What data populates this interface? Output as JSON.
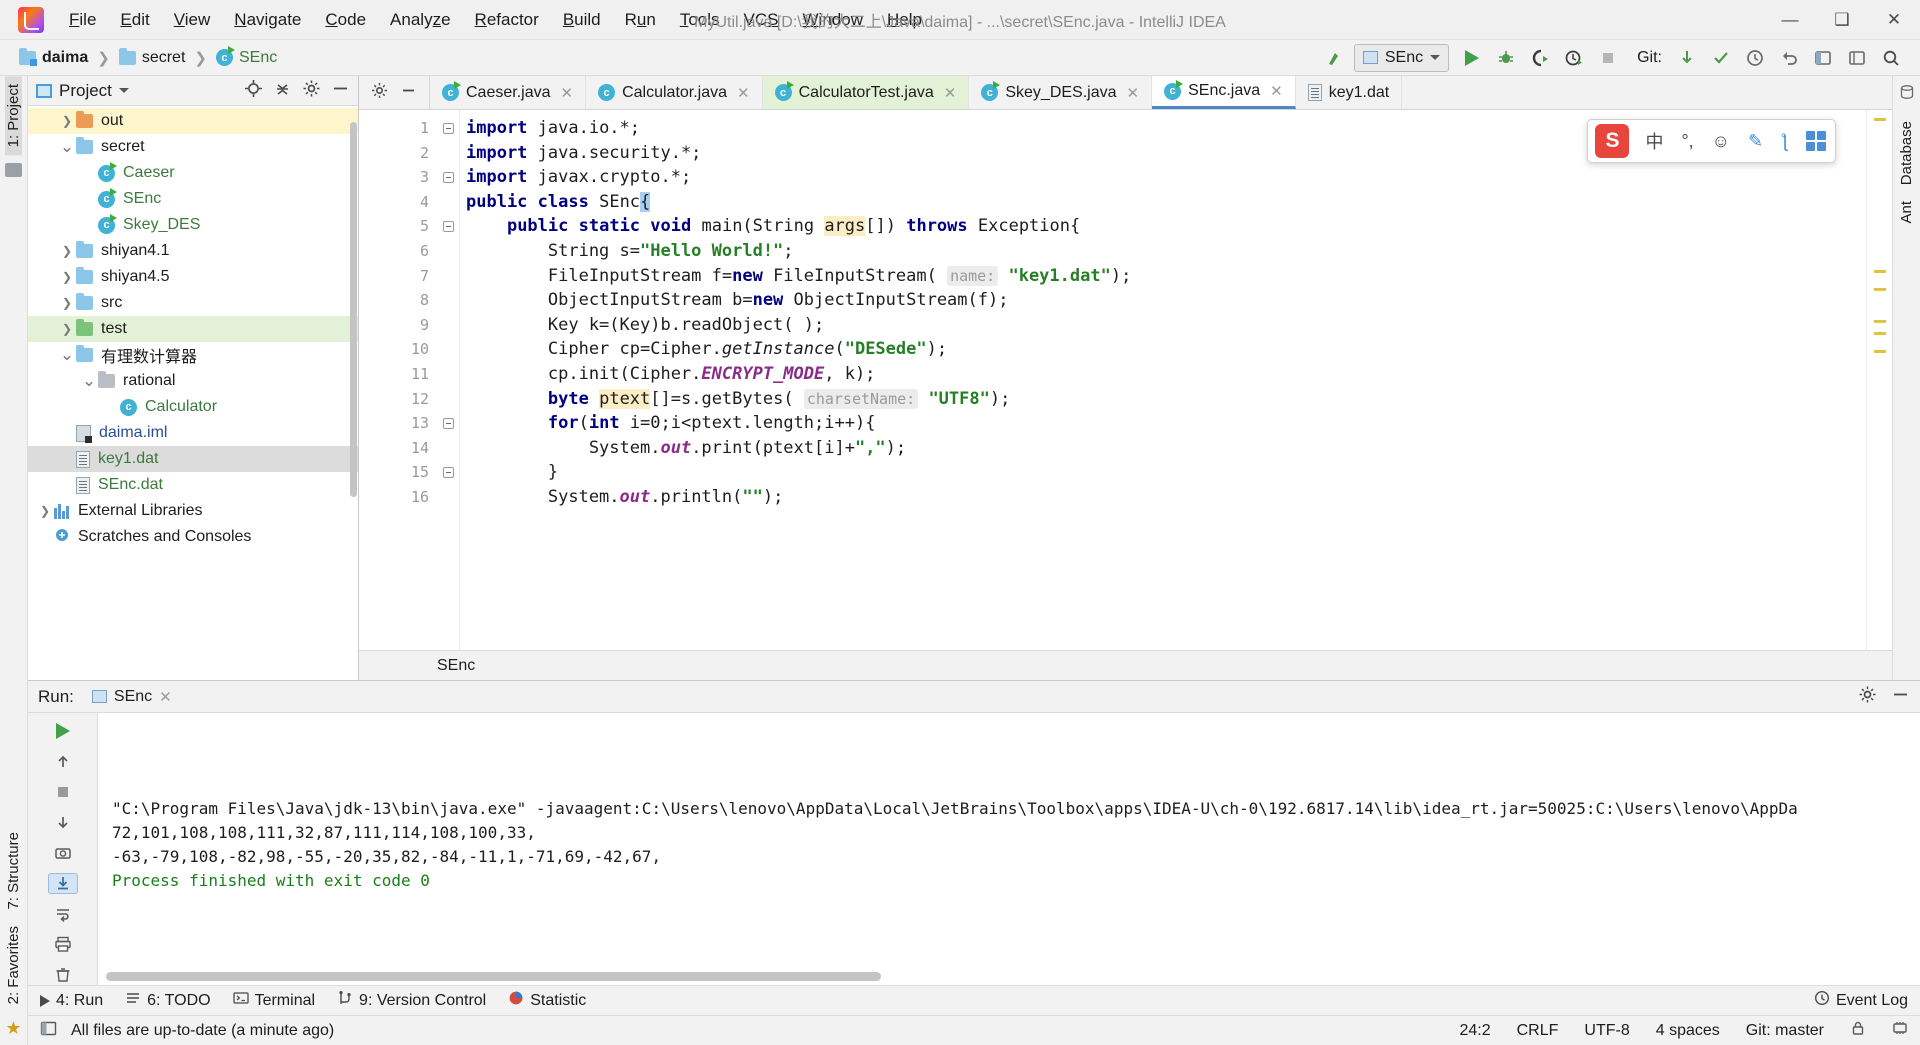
{
  "titlebar": {
    "logo": "intellij-logo",
    "window_title": "MyUtil.java [D:\\我的大二上\\Java\\daima] - ...\\secret\\SEnc.java - IntelliJ IDEA",
    "menus": [
      {
        "label": "File"
      },
      {
        "label": "Edit"
      },
      {
        "label": "View"
      },
      {
        "label": "Navigate"
      },
      {
        "label": "Code"
      },
      {
        "label": "Analyze"
      },
      {
        "label": "Refactor"
      },
      {
        "label": "Build"
      },
      {
        "label": "Run"
      },
      {
        "label": "Tools"
      },
      {
        "label": "VCS"
      },
      {
        "label": "Window"
      },
      {
        "label": "Help"
      }
    ],
    "minimize": "—",
    "maximize": "❑",
    "close": "✕"
  },
  "navbar": {
    "breadcrumbs": [
      {
        "label": "daima",
        "icon": "module-folder-icon"
      },
      {
        "label": "secret",
        "icon": "folder-icon"
      },
      {
        "label": "SEnc",
        "icon": "java-class-icon"
      }
    ],
    "separator": "❯",
    "run_config": "SEnc",
    "git_label": "Git:",
    "buttons": [
      {
        "name": "search-everywhere-icon"
      },
      {
        "name": "run-icon"
      },
      {
        "name": "debug-icon"
      },
      {
        "name": "run-coverage-icon"
      },
      {
        "name": "profiler-icon"
      },
      {
        "name": "stop-icon"
      },
      {
        "name": "git-update-icon"
      },
      {
        "name": "git-commit-icon"
      },
      {
        "name": "git-history-icon"
      },
      {
        "name": "git-rollback-icon"
      },
      {
        "name": "project-structure-icon"
      },
      {
        "name": "settings-icon"
      },
      {
        "name": "search-icon"
      }
    ]
  },
  "left_rail": {
    "project_tab": "1: Project",
    "structure_tab": "7: Structure",
    "favorites_tab": "2: Favorites"
  },
  "right_rail": {
    "database_tab": "Database",
    "ant_tab": "Ant"
  },
  "project_panel": {
    "title": "Project",
    "dropdown": "▾",
    "actions": [
      {
        "name": "locate-file-icon"
      },
      {
        "name": "collapse-all-icon"
      },
      {
        "name": "settings-icon"
      },
      {
        "name": "hide-icon"
      }
    ],
    "tree": [
      {
        "label": "out",
        "indent": 1,
        "arrow": "collapsed",
        "icon": "folder-orange",
        "color": "dark",
        "state": "yellow"
      },
      {
        "label": "secret",
        "indent": 1,
        "arrow": "expanded",
        "icon": "folder-blue",
        "color": "dark",
        "state": "none"
      },
      {
        "label": "Caeser",
        "indent": 2,
        "arrow": "none",
        "icon": "java-class-runnable",
        "color": "green",
        "state": "none"
      },
      {
        "label": "SEnc",
        "indent": 2,
        "arrow": "none",
        "icon": "java-class-runnable",
        "color": "green",
        "state": "none"
      },
      {
        "label": "Skey_DES",
        "indent": 2,
        "arrow": "none",
        "icon": "java-class-runnable",
        "color": "green",
        "state": "none"
      },
      {
        "label": "shiyan4.1",
        "indent": 1,
        "arrow": "collapsed",
        "icon": "folder-blue",
        "color": "dark",
        "state": "none"
      },
      {
        "label": "shiyan4.5",
        "indent": 1,
        "arrow": "collapsed",
        "icon": "folder-blue",
        "color": "dark",
        "state": "none"
      },
      {
        "label": "src",
        "indent": 1,
        "arrow": "collapsed",
        "icon": "folder-blue",
        "color": "dark",
        "state": "none"
      },
      {
        "label": "test",
        "indent": 1,
        "arrow": "collapsed",
        "icon": "folder-green",
        "color": "dark",
        "state": "green"
      },
      {
        "label": "有理数计算器",
        "indent": 1,
        "arrow": "expanded",
        "icon": "folder-blue",
        "color": "dark",
        "state": "none"
      },
      {
        "label": "rational",
        "indent": 2,
        "arrow": "expanded",
        "icon": "folder-grey",
        "color": "dark",
        "state": "none"
      },
      {
        "label": "Calculator",
        "indent": 3,
        "arrow": "none",
        "icon": "java-class",
        "color": "green",
        "state": "none"
      },
      {
        "label": "daima.iml",
        "indent": 1,
        "arrow": "none",
        "icon": "iml-file",
        "color": "blue",
        "state": "none"
      },
      {
        "label": "key1.dat",
        "indent": 1,
        "arrow": "none",
        "icon": "dat-file",
        "color": "green",
        "state": "grey"
      },
      {
        "label": "SEnc.dat",
        "indent": 1,
        "arrow": "none",
        "icon": "dat-file",
        "color": "green",
        "state": "none"
      },
      {
        "label": "External Libraries",
        "indent": 0,
        "arrow": "collapsed",
        "icon": "library-icon",
        "color": "dark",
        "state": "none"
      },
      {
        "label": "Scratches and Consoles",
        "indent": 0,
        "arrow": "none",
        "icon": "scratches-icon",
        "color": "dark",
        "state": "none"
      }
    ]
  },
  "editor": {
    "tabs": [
      {
        "label": "Caeser.java",
        "icon": "java-class-runnable",
        "state": "normal"
      },
      {
        "label": "Calculator.java",
        "icon": "java-class",
        "state": "normal"
      },
      {
        "label": "CalculatorTest.java",
        "icon": "java-test-class",
        "state": "green"
      },
      {
        "label": "Skey_DES.java",
        "icon": "java-class-runnable",
        "state": "normal"
      },
      {
        "label": "SEnc.java",
        "icon": "java-class-runnable",
        "state": "selected"
      },
      {
        "label": "key1.dat",
        "icon": "dat-file",
        "state": "plain"
      }
    ],
    "tab_close": "✕",
    "breadcrumb": "SEnc",
    "lines": [
      {
        "n": "1",
        "fold": "start",
        "run": false
      },
      {
        "n": "2",
        "fold": "none",
        "run": false
      },
      {
        "n": "3",
        "fold": "end",
        "run": false
      },
      {
        "n": "4",
        "fold": "none",
        "run": true
      },
      {
        "n": "5",
        "fold": "start",
        "run": true
      },
      {
        "n": "6",
        "fold": "none",
        "run": false
      },
      {
        "n": "7",
        "fold": "none",
        "run": false
      },
      {
        "n": "8",
        "fold": "none",
        "run": false
      },
      {
        "n": "9",
        "fold": "none",
        "run": false
      },
      {
        "n": "10",
        "fold": "none",
        "run": false
      },
      {
        "n": "11",
        "fold": "none",
        "run": false
      },
      {
        "n": "12",
        "fold": "none",
        "run": false
      },
      {
        "n": "13",
        "fold": "start",
        "run": false
      },
      {
        "n": "14",
        "fold": "none",
        "run": false
      },
      {
        "n": "15",
        "fold": "end",
        "run": false
      },
      {
        "n": "16",
        "fold": "none",
        "run": false
      }
    ],
    "code_text": [
      "import java.io.*;",
      "import java.security.*;",
      "import javax.crypto.*;",
      "public class SEnc{",
      "    public static void main(String args[]) throws Exception{",
      "        String s=\"Hello World!\";",
      "        FileInputStream f=new FileInputStream( name: \"key1.dat\");",
      "        ObjectInputStream b=new ObjectInputStream(f);",
      "        Key k=(Key)b.readObject( );",
      "        Cipher cp=Cipher.getInstance(\"DESede\");",
      "        cp.init(Cipher.ENCRYPT_MODE, k);",
      "        byte ptext[]=s.getBytes( charsetName: \"UTF8\");",
      "        for(int i=0;i<ptext.length;i++){",
      "            System.out.print(ptext[i]+\",\");",
      "        }",
      "        System.out.println(\"\");"
    ],
    "inlay_hints": [
      {
        "line": 7,
        "text": "name:"
      },
      {
        "line": 12,
        "text": "charsetName:"
      }
    ]
  },
  "ime": {
    "logo": "S",
    "items": [
      {
        "name": "chinese-mode-icon",
        "glyph": "中"
      },
      {
        "name": "punctuation-icon",
        "glyph": "°,"
      },
      {
        "name": "emoji-icon",
        "glyph": "☺"
      },
      {
        "name": "pen-icon",
        "glyph": "✎"
      },
      {
        "name": "mic-icon",
        "glyph": "ƪ"
      },
      {
        "name": "apps-grid-icon",
        "glyph": "grid"
      }
    ]
  },
  "run_panel": {
    "title": "Run:",
    "tab_label": "SEnc",
    "close": "✕",
    "settings_icon": "gear-icon",
    "hide_icon": "hide-icon",
    "side_buttons": [
      {
        "name": "rerun-button"
      },
      {
        "name": "stop-button"
      },
      {
        "name": "screenshot-button"
      },
      {
        "name": "thread-dump-button"
      },
      {
        "name": "scroll-up-button"
      },
      {
        "name": "scroll-down-button"
      },
      {
        "name": "soft-wrap-button"
      },
      {
        "name": "scroll-to-end-button"
      },
      {
        "name": "print-button"
      },
      {
        "name": "clear-all-button"
      }
    ],
    "console_lines": [
      {
        "text": "\"C:\\Program Files\\Java\\jdk-13\\bin\\java.exe\" -javaagent:C:\\Users\\lenovo\\AppData\\Local\\JetBrains\\Toolbox\\apps\\IDEA-U\\ch-0\\192.6817.14\\lib\\idea_rt.jar=50025:C:\\Users\\lenovo\\AppDa",
        "style": "normal"
      },
      {
        "text": "72,101,108,108,111,32,87,111,114,108,100,33,",
        "style": "normal"
      },
      {
        "text": "-63,-79,108,-82,98,-55,-20,35,82,-84,-11,1,-71,69,-42,67,",
        "style": "normal"
      },
      {
        "text": "Process finished with exit code 0",
        "style": "ok"
      }
    ]
  },
  "bottom_toolbar": {
    "items": [
      {
        "label": "4: Run",
        "icon": "run-icon"
      },
      {
        "label": "6: TODO",
        "icon": "todo-icon"
      },
      {
        "label": "Terminal",
        "icon": "terminal-icon"
      },
      {
        "label": "9: Version Control",
        "icon": "version-control-icon"
      },
      {
        "label": "Statistic",
        "icon": "statistic-icon"
      }
    ],
    "event_log": "Event Log"
  },
  "statusbar": {
    "message": "All files are up-to-date (a minute ago)",
    "caret_position": "24:2",
    "line_separator": "CRLF",
    "encoding": "UTF-8",
    "indent": "4 spaces",
    "branch": "Git: master",
    "icons": [
      {
        "name": "toggle-sidebar-icon"
      },
      {
        "name": "lock-icon"
      },
      {
        "name": "memory-indicator-icon"
      }
    ]
  },
  "colors": {
    "accent_blue": "#4c87c9",
    "tab_active_green": "#e3f2d7",
    "selection_yellow": "#fdf6cd",
    "keyword": "#000080",
    "string": "#267f26",
    "static_field": "#8a2b8a",
    "run_green": "#43a047"
  }
}
